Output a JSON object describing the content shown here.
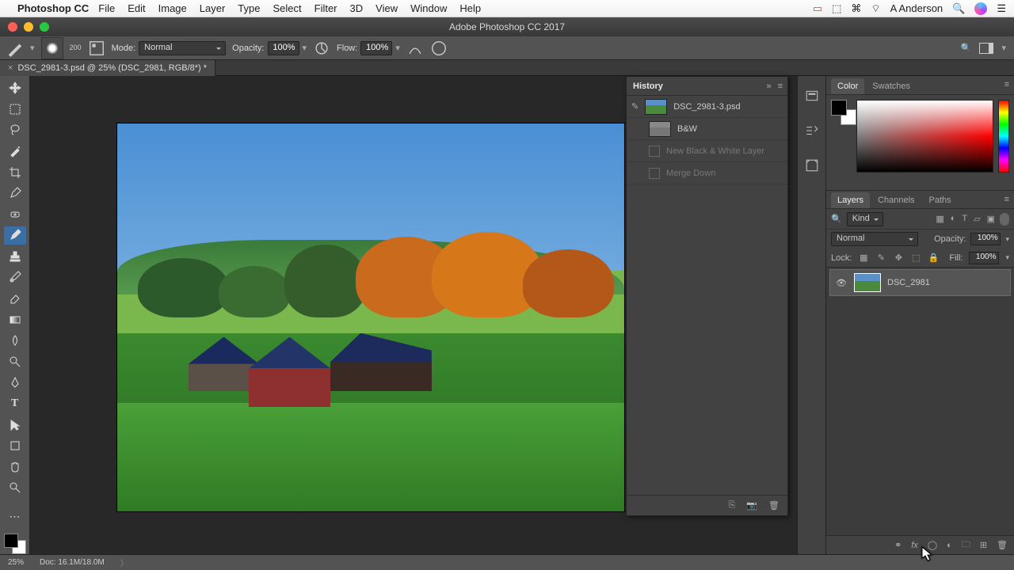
{
  "menubar": {
    "app_name": "Photoshop CC",
    "items": [
      "File",
      "Edit",
      "Image",
      "Layer",
      "Type",
      "Select",
      "Filter",
      "3D",
      "View",
      "Window",
      "Help"
    ],
    "user": "A Anderson"
  },
  "window": {
    "title": "Adobe Photoshop CC 2017"
  },
  "options": {
    "brush_size": "200",
    "mode_label": "Mode:",
    "mode_value": "Normal",
    "opacity_label": "Opacity:",
    "opacity_value": "100%",
    "flow_label": "Flow:",
    "flow_value": "100%"
  },
  "doc_tab": {
    "title": "DSC_2981-3.psd @ 25% (DSC_2981, RGB/8*) *"
  },
  "history": {
    "title": "History",
    "rows": [
      {
        "label": "DSC_2981-3.psd",
        "kind": "source"
      },
      {
        "label": "B&W",
        "kind": "source"
      },
      {
        "label": "New Black & White Layer",
        "kind": "step-dim"
      },
      {
        "label": "Merge Down",
        "kind": "step-dim"
      }
    ]
  },
  "color_panel": {
    "tabs": [
      "Color",
      "Swatches"
    ],
    "active": 0
  },
  "layers_panel": {
    "tabs": [
      "Layers",
      "Channels",
      "Paths"
    ],
    "active": 0,
    "kind_label": "Kind",
    "blend_mode": "Normal",
    "opacity_label": "Opacity:",
    "opacity_value": "100%",
    "lock_label": "Lock:",
    "fill_label": "Fill:",
    "fill_value": "100%",
    "layers": [
      {
        "name": "DSC_2981",
        "visible": true
      }
    ]
  },
  "status": {
    "zoom": "25%",
    "doc_info": "Doc: 16.1M/18.0M"
  }
}
